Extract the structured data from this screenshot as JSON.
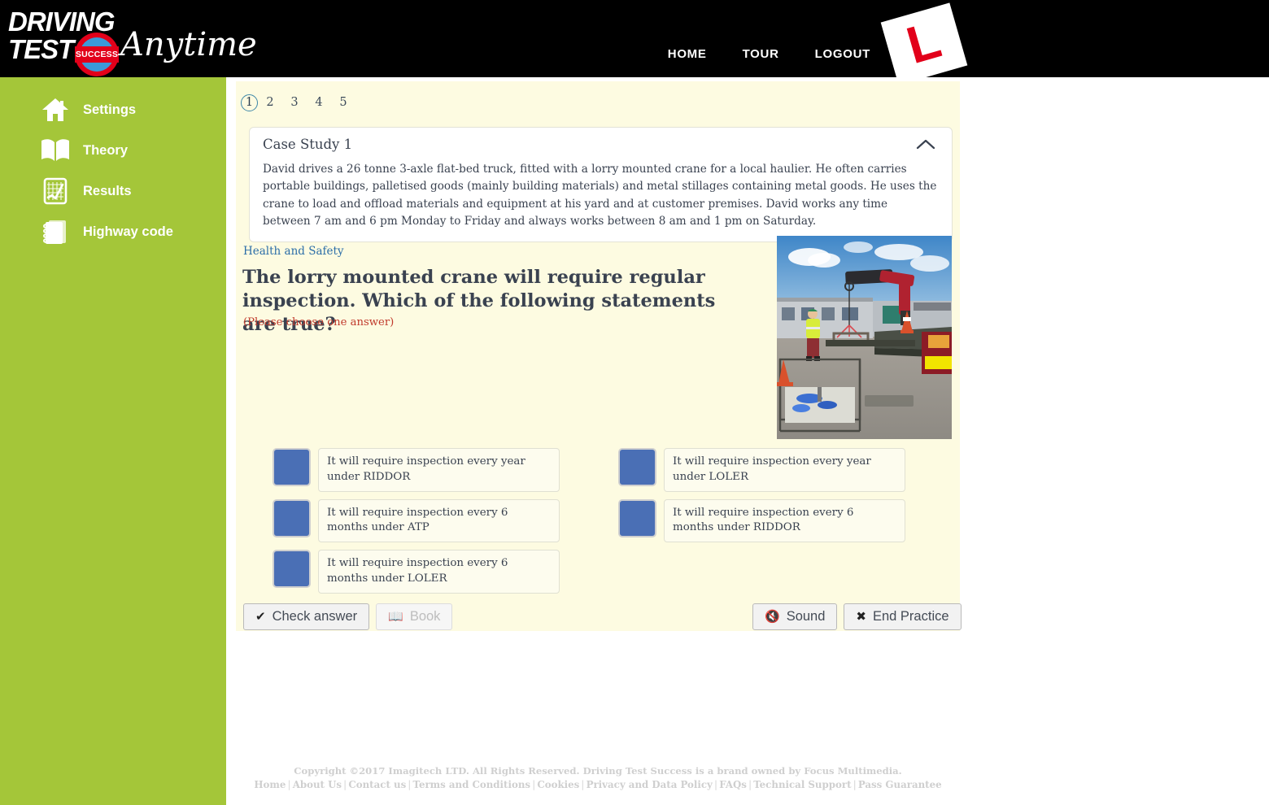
{
  "brand": {
    "line1": "DRIVING",
    "line2": "TEST",
    "badge": "SUCCESS",
    "script": "Anytime",
    "lplate": "L"
  },
  "nav": {
    "items": [
      {
        "label": "HOME"
      },
      {
        "label": "TOUR"
      },
      {
        "label": "LOGOUT"
      }
    ]
  },
  "sidebar": {
    "background": "#a4c639",
    "items": [
      {
        "label": "Settings",
        "icon": "home-icon"
      },
      {
        "label": "Theory",
        "icon": "book-icon"
      },
      {
        "label": "Results",
        "icon": "results-chart-icon"
      },
      {
        "label": "Highway code",
        "icon": "notebook-icon"
      }
    ]
  },
  "pager": {
    "pages": [
      "1",
      "2",
      "3",
      "4",
      "5"
    ],
    "active": "1",
    "active_ring_color": "#3d87a8"
  },
  "case_study": {
    "title": "Case Study 1",
    "collapse_icon": "chevron-up-icon",
    "body": "David drives a 26 tonne 3-axle flat-bed truck, fitted with a lorry mounted crane for a local haulier. He often carries portable buildings, palletised goods (mainly building materials) and metal stillages containing metal goods. He uses the crane to load and offload materials and equipment at his yard and at customer premises. David works any time between 7 am and 6 pm Monday to Friday and always works between 8 am and 1 pm on Saturday."
  },
  "question": {
    "category": "Health and Safety",
    "text": "The lorry mounted crane will require regular inspection. Which of the following statements are true?",
    "note": "(Please choose one answer)",
    "note_color": "#c0392b",
    "image_alt": "Lorry mounted crane lifting a load at a yard with a worker in a hi-vis jacket"
  },
  "answers": {
    "checkbox_color": "#4a6fb5",
    "left": [
      {
        "text": "It will require inspection every year under RIDDOR"
      },
      {
        "text": "It will require inspection every 6 months under ATP"
      },
      {
        "text": "It will require inspection every 6 months under LOLER"
      }
    ],
    "right": [
      {
        "text": "It will require inspection every year under LOLER"
      },
      {
        "text": "It will require inspection every 6 months under RIDDOR"
      }
    ]
  },
  "buttons": {
    "check_answer": "Check answer",
    "book": "Book",
    "sound": "Sound",
    "end_practice": "End Practice"
  },
  "footer": {
    "copyright": "Copyright ©2017 Imagitech LTD. All Rights Reserved. Driving Test Success is a brand owned by Focus Multimedia.",
    "links": [
      "Home",
      "About Us",
      "Contact us",
      "Terms and Conditions",
      "Cookies",
      "Privacy and Data Policy",
      "FAQs",
      "Technical Support",
      "Pass Guarantee"
    ]
  }
}
